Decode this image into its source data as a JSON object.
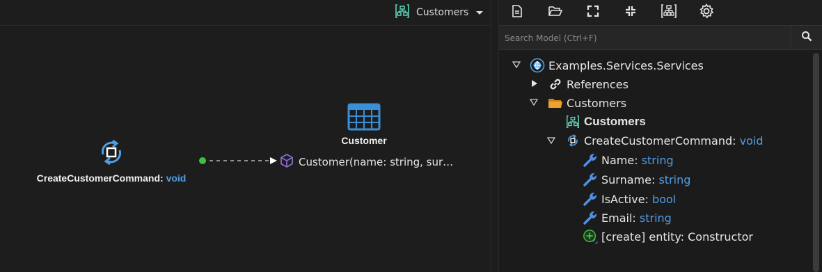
{
  "canvas": {
    "diagram_selector": {
      "label": "Customers",
      "icon": "diagram-icon"
    },
    "command_node": {
      "name": "CreateCustomerCommand",
      "separator": ":",
      "type": "void",
      "icon": "command-cycle-icon"
    },
    "entity_node": {
      "name": "Customer",
      "icon": "table-entity-icon"
    },
    "association_label": {
      "text": "Customer(name: string, sur…",
      "icon": "cube-icon"
    }
  },
  "toolbar": {
    "buttons": [
      {
        "name": "new-file-button",
        "icon": "new-file-icon"
      },
      {
        "name": "open-folder-button",
        "icon": "folder-open-icon"
      },
      {
        "name": "expand-button",
        "icon": "expand-icon"
      },
      {
        "name": "collapse-button",
        "icon": "collapse-icon"
      },
      {
        "name": "layout-button",
        "icon": "layout-icon"
      },
      {
        "name": "settings-button",
        "icon": "gear-icon"
      }
    ]
  },
  "search": {
    "placeholder": "Search Model (Ctrl+F)",
    "value": ""
  },
  "tree": {
    "root": {
      "label": "Examples.Services.Services",
      "icon": "package-globe-icon"
    },
    "references": {
      "label": "References",
      "icon": "link-icon"
    },
    "customers_folder": {
      "label": "Customers",
      "icon": "folder-icon"
    },
    "customers_diagram": {
      "label": "Customers",
      "icon": "diagram-icon"
    },
    "command": {
      "label": "CreateCustomerCommand",
      "separator": ":",
      "type": "void",
      "icon": "command-cycle-icon"
    },
    "fields": [
      {
        "name": "Name",
        "separator": ":",
        "type": "string"
      },
      {
        "name": "Surname",
        "separator": ":",
        "type": "string"
      },
      {
        "name": "IsActive",
        "separator": ":",
        "type": "bool"
      },
      {
        "name": "Email",
        "separator": ":",
        "type": "string"
      }
    ],
    "mapping": {
      "label": "[create] entity: Constructor",
      "icon": "create-mapping-icon"
    }
  },
  "colors": {
    "accent": "#4f9fe6",
    "background": "#1e1e1e",
    "panel": "#1b1b1b",
    "connector_start": "#3cc13c",
    "diagram_icon": "#5fd1b8",
    "entity_icon": "#3a8fd6",
    "cube_icon": "#8e6bd6",
    "folder_icon": "#f0a030",
    "wrench_icon": "#4f8fe6"
  }
}
